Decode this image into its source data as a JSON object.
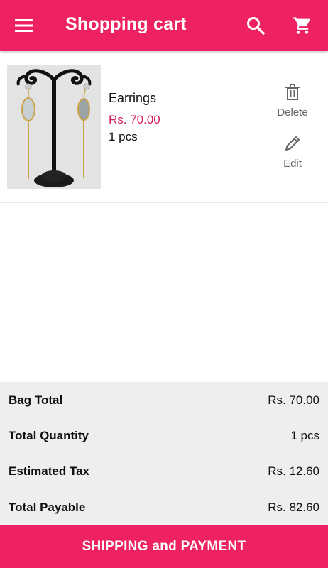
{
  "appbar": {
    "title": "Shopping cart",
    "icons": {
      "menu": "menu-icon",
      "search": "search-icon",
      "cart": "cart-icon"
    },
    "color": "#EE2163"
  },
  "cart": {
    "items": [
      {
        "name": "Earrings",
        "price": "Rs. 70.00",
        "quantity": "1 pcs",
        "image": "earrings-on-stand",
        "delete_label": "Delete",
        "edit_label": "Edit"
      }
    ]
  },
  "summary": {
    "rows": [
      {
        "label": "Bag Total",
        "value": "Rs. 70.00"
      },
      {
        "label": "Total Quantity",
        "value": "1 pcs"
      },
      {
        "label": "Estimated Tax",
        "value": "Rs. 12.60"
      },
      {
        "label": "Total Payable",
        "value": "Rs. 82.60"
      }
    ]
  },
  "checkout": {
    "label": "SHIPPING and PAYMENT"
  },
  "colors": {
    "accent": "#EE2163",
    "price": "#D81B60",
    "summary_bg": "#EEEEEE"
  }
}
